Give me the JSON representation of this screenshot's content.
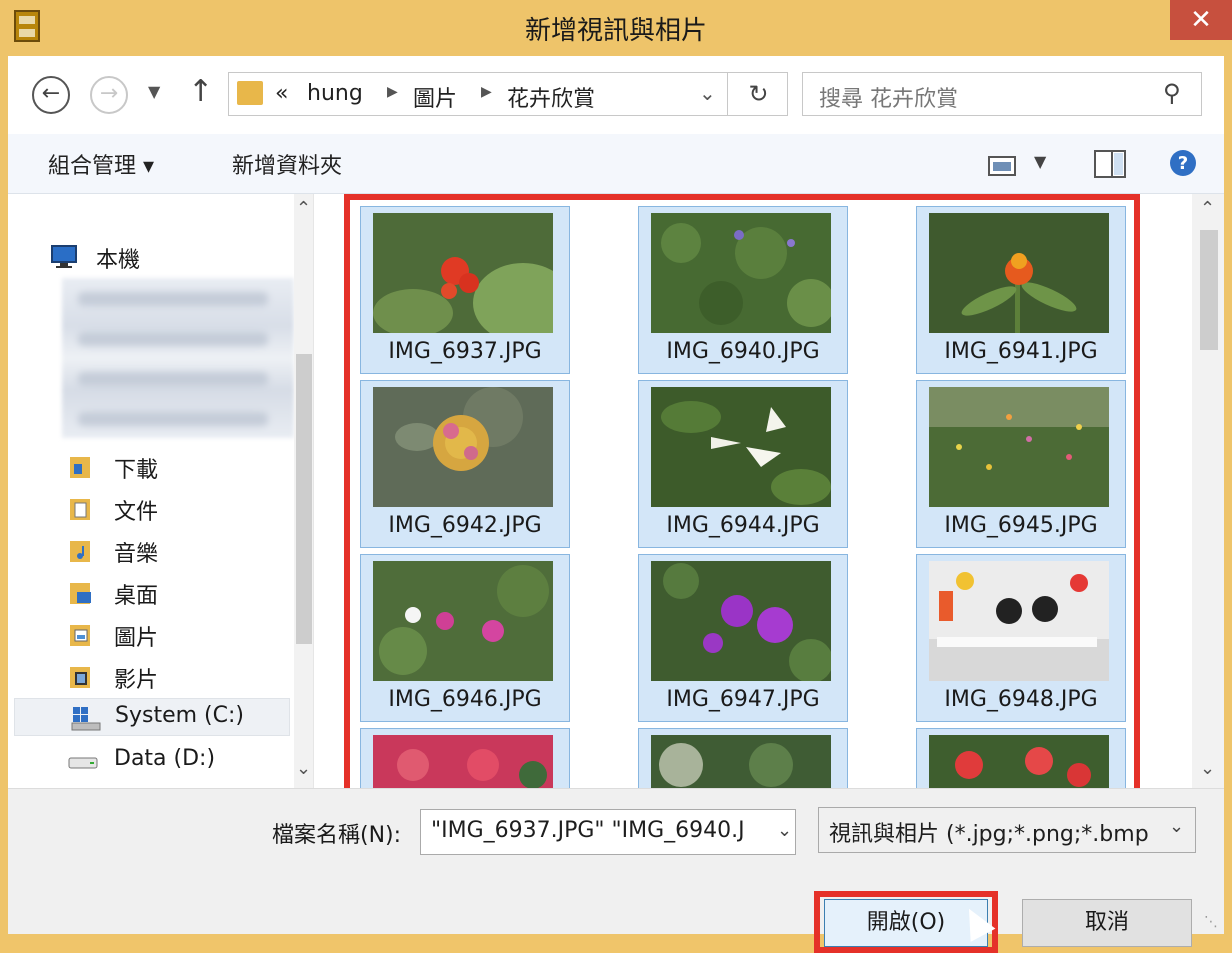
{
  "window": {
    "title": "新增視訊與相片",
    "close_label": "✕"
  },
  "address_bar": {
    "crumbs": [
      "«",
      "hung",
      "圖片",
      "花卉欣賞"
    ],
    "refresh_glyph": "↻"
  },
  "search": {
    "placeholder": "搜尋 花卉欣賞"
  },
  "toolbar": {
    "organize_label": "組合管理 ▾",
    "new_folder_label": "新增資料夾"
  },
  "nav": {
    "this_pc": "本機",
    "items": [
      {
        "label": "下載",
        "icon": "download-folder-icon"
      },
      {
        "label": "文件",
        "icon": "documents-folder-icon"
      },
      {
        "label": "音樂",
        "icon": "music-folder-icon"
      },
      {
        "label": "桌面",
        "icon": "desktop-folder-icon"
      },
      {
        "label": "圖片",
        "icon": "pictures-folder-icon"
      },
      {
        "label": "影片",
        "icon": "videos-folder-icon"
      },
      {
        "label": "System (C:)",
        "icon": "system-drive-icon"
      },
      {
        "label": "Data (D:)",
        "icon": "data-drive-icon"
      }
    ]
  },
  "files": [
    {
      "name": "IMG_6937.JPG"
    },
    {
      "name": "IMG_6940.JPG"
    },
    {
      "name": "IMG_6941.JPG"
    },
    {
      "name": "IMG_6942.JPG"
    },
    {
      "name": "IMG_6944.JPG"
    },
    {
      "name": "IMG_6945.JPG"
    },
    {
      "name": "IMG_6946.JPG"
    },
    {
      "name": "IMG_6947.JPG"
    },
    {
      "name": "IMG_6948.JPG"
    },
    {
      "name": ""
    },
    {
      "name": ""
    },
    {
      "name": ""
    }
  ],
  "bottom": {
    "filename_label": "檔案名稱(N):",
    "filename_value": "\"IMG_6937.JPG\" \"IMG_6940.J",
    "filetype_value": "視訊與相片 (*.jpg;*.png;*.bmp",
    "open_label": "開啟(O)",
    "cancel_label": "取消"
  },
  "colors": {
    "title_bar": "#eec46a",
    "close_button": "#c7503e",
    "highlight_border": "#e53129",
    "selection_fill": "#d3e6f8",
    "selection_border": "#88b6e0"
  }
}
